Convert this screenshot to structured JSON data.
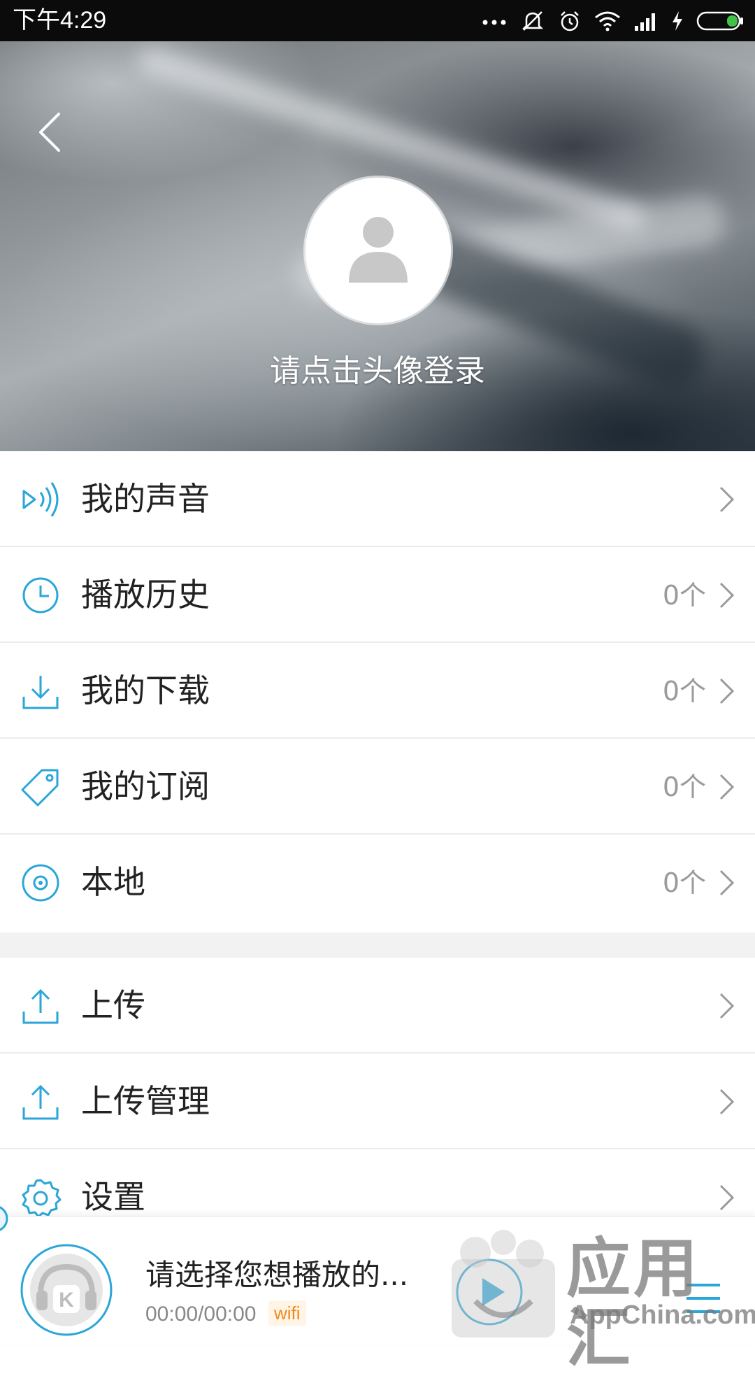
{
  "status_bar": {
    "time": "下午4:29",
    "icons": [
      "more-dots-icon",
      "mute-icon",
      "alarm-icon",
      "wifi-icon",
      "signal-icon",
      "charging-icon",
      "battery-icon"
    ]
  },
  "header": {
    "back_icon": "chevron-left-icon",
    "avatar_icon": "user-placeholder-icon",
    "login_prompt": "请点击头像登录"
  },
  "menu": {
    "items": [
      {
        "label": "我的声音",
        "count": "",
        "icon": "sound-wave-icon"
      },
      {
        "label": "播放历史",
        "count": "0个",
        "icon": "clock-icon"
      },
      {
        "label": "我的下载",
        "count": "0个",
        "icon": "download-icon"
      },
      {
        "label": "我的订阅",
        "count": "0个",
        "icon": "tag-icon"
      },
      {
        "label": "本地",
        "count": "0个",
        "icon": "disc-icon"
      },
      {
        "label": "上传",
        "count": "",
        "icon": "upload-icon"
      },
      {
        "label": "上传管理",
        "count": "",
        "icon": "upload-manage-icon"
      },
      {
        "label": "设置",
        "count": "",
        "icon": "gear-icon"
      }
    ]
  },
  "player": {
    "title": "请选择您想播放的...",
    "time": "00:00/00:00",
    "network_badge": "wifi"
  },
  "watermark": {
    "cn": "应用汇",
    "en": "AppChina.com"
  },
  "colors": {
    "accent": "#2aa6d8",
    "text": "#222222",
    "muted": "#9a9a9a",
    "badge_text": "#f08a1a"
  }
}
